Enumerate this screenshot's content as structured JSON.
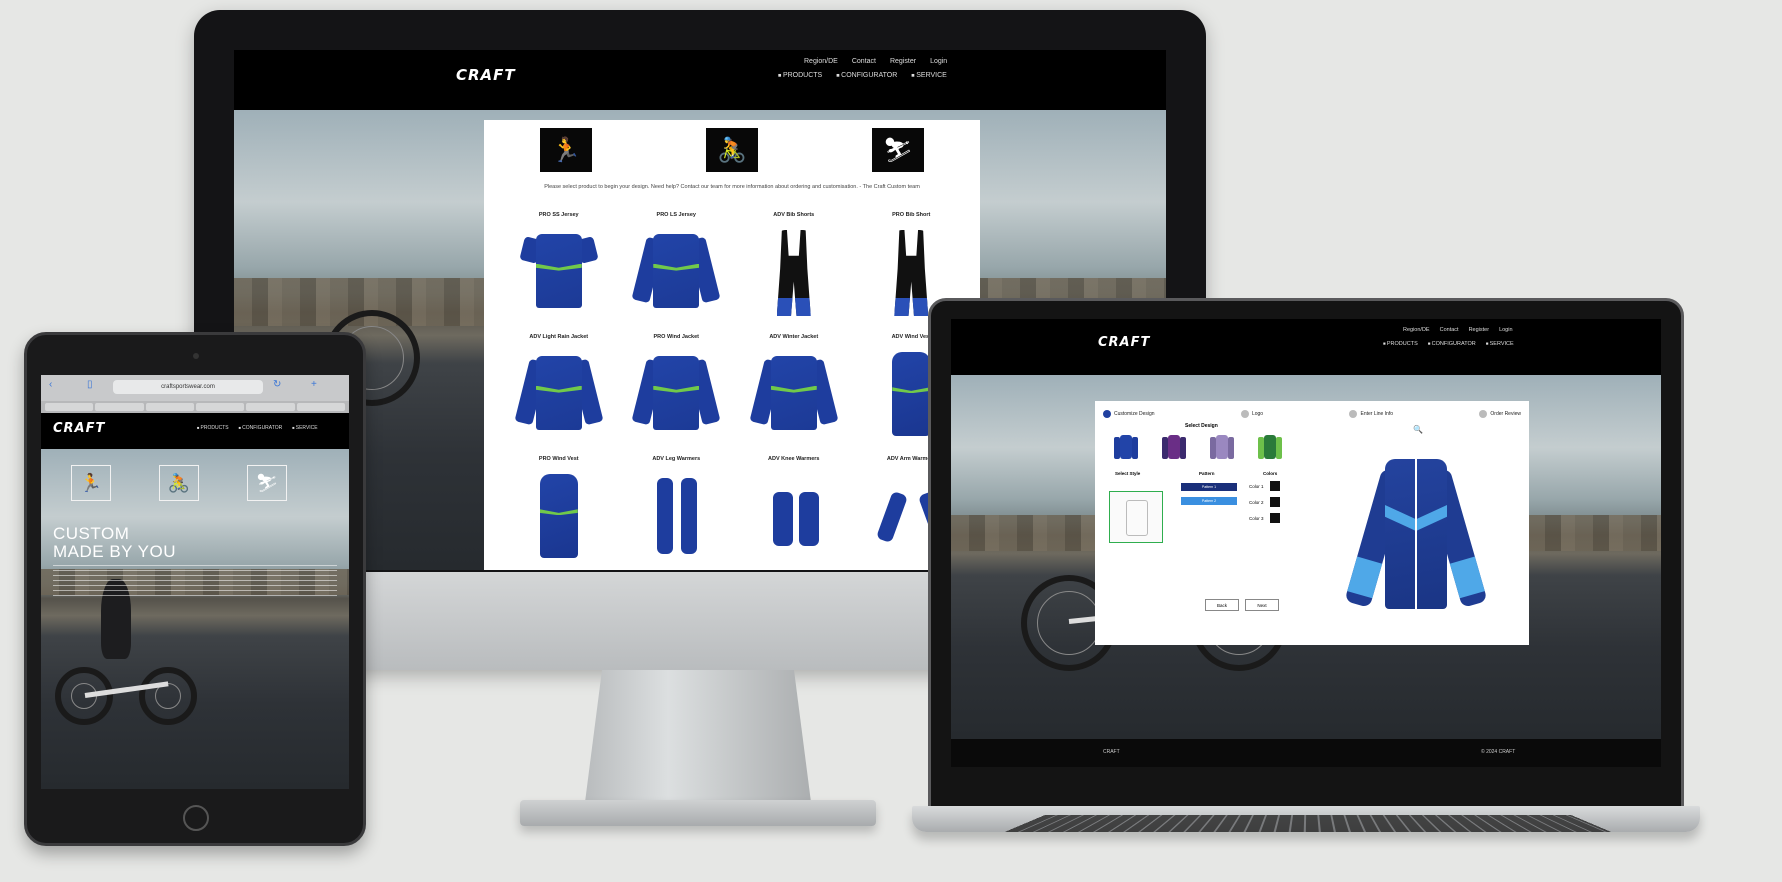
{
  "imac": {
    "logo": "CRAFT",
    "nav_links": [
      "Region/DE",
      "Contact",
      "Register",
      "Login"
    ],
    "nav_products": [
      "PRODUCTS",
      "CONFIGURATOR",
      "SERVICE"
    ],
    "sport_icons": [
      "running-icon",
      "cycling-icon",
      "cross-country-ski-icon"
    ],
    "intro": "Please select product to begin your design. Need help? Contact our team for more information about ordering and customisation. - The Craft Custom team",
    "row_labels": [
      [
        "PRO SS Jersey",
        "PRO LS Jersey",
        "ADV Bib Shorts",
        "PRO Bib Short"
      ],
      [
        "ADV Light Rain Jacket",
        "PRO Wind Jacket",
        "ADV Winter Jacket",
        "ADV Wind Vest"
      ],
      [
        "PRO Wind Vest",
        "ADV Leg Warmers",
        "ADV Knee Warmers",
        "ADV Arm Warmers"
      ]
    ]
  },
  "ipad": {
    "url": "craftsportswear.com",
    "logo": "CRAFT",
    "nav_products": [
      "PRODUCTS",
      "CONFIGURATOR",
      "SERVICE"
    ],
    "sport_icons": [
      "running-icon",
      "cycling-icon",
      "cross-country-ski-icon"
    ],
    "hero_line1": "CUSTOM",
    "hero_line2": "MADE BY YOU"
  },
  "macbook": {
    "logo": "CRAFT",
    "nav_links": [
      "Region/DE",
      "Contact",
      "Register",
      "Login"
    ],
    "nav_products": [
      "PRODUCTS",
      "CONFIGURATOR",
      "SERVICE"
    ],
    "steps": [
      "Customize Design",
      "Logo",
      "Enter Line Info",
      "Order Review"
    ],
    "select_design": "Select Design",
    "col_style": "Select Style",
    "col_pattern": "Pattern",
    "col_colors": "Colors",
    "pattern_options": [
      "Pattern 1",
      "Pattern 2"
    ],
    "color_rows": [
      "Color 1",
      "Color 2",
      "Color 3"
    ],
    "back_label": "Back",
    "next_label": "Next",
    "footer_left": "CRAFT",
    "footer_right": "© 2024 CRAFT",
    "colors": {
      "navy": "#1e3d9e",
      "accent_green": "#71c94a",
      "accent_blue": "#4fa8e8",
      "active_step": "#2040a0"
    }
  }
}
